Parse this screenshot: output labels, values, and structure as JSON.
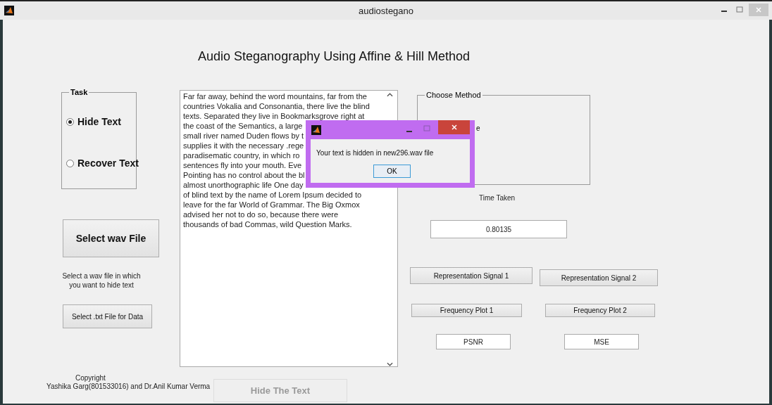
{
  "window": {
    "title": "audiostegano"
  },
  "heading": "Audio Steganography Using Affine & Hill Method",
  "task_panel": {
    "title": "Task",
    "options": [
      {
        "label": "Hide Text",
        "selected": true
      },
      {
        "label": "Recover Text",
        "selected": false
      }
    ]
  },
  "select_wav_button": "Select wav File",
  "select_wav_hint": [
    "Select a wav file in which",
    "you want to hide text"
  ],
  "select_txt_button": "Select .txt File for Data",
  "copyright": [
    "Copyright",
    "Yashika Garg(801533016) and Dr.Anil Kumar Verma"
  ],
  "text_area": {
    "lines": [
      "Far far away, behind the word mountains, far from the",
      "countries Vokalia and Consonantia, there live the blind",
      "texts. Separated they live in Bookmarksgrove right at",
      "the coast of the Semantics, a large",
      "small river named Duden flows by t",
      "supplies it with the necessary .rege",
      "paradisematic country, in which ro",
      "sentences fly into your mouth. Eve",
      "Pointing has no control about the bl",
      "almost unorthographic life One day",
      "of blind text by the name of Lorem Ipsum decided to",
      "leave for the far World of Grammar. The Big Oxmox",
      "advised her not to do so, because there were",
      "thousands of bad Commas, wild Question Marks."
    ]
  },
  "hide_button": {
    "label": "Hide The Text",
    "disabled": true
  },
  "method_panel": {
    "title": "Choose Method",
    "visible_text": "e"
  },
  "time_taken": {
    "label": "Time Taken",
    "value": "0.80135"
  },
  "plot_buttons": [
    "Representation Signal 1",
    "Representation Signal 2",
    "Frequency Plot 1",
    "Frequency Plot 2"
  ],
  "metrics": [
    {
      "placeholder": "PSNR"
    },
    {
      "placeholder": "MSE"
    }
  ],
  "dialog": {
    "message": "Your text is hidden in  new296.wav file",
    "button": "OK"
  }
}
